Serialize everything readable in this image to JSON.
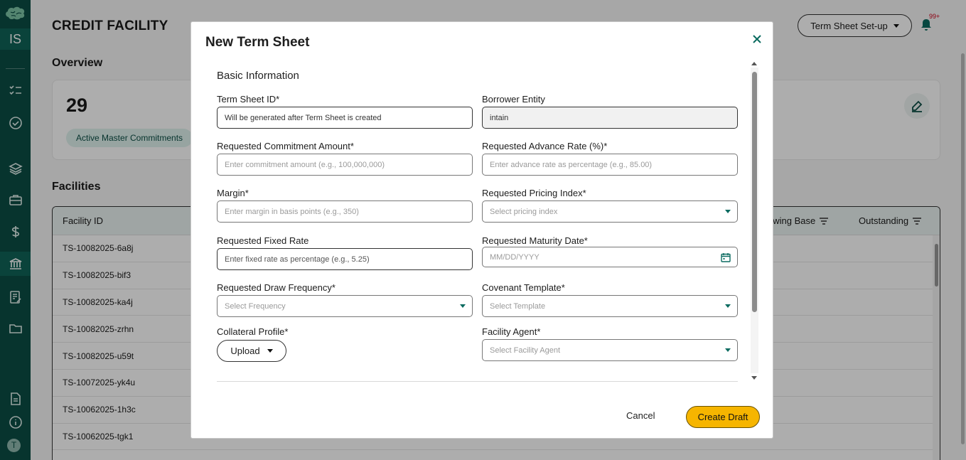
{
  "sidebar": {
    "initials": "IS",
    "avatar": "T",
    "icons": [
      "brain-logo-icon",
      "checklist-icon",
      "check-circle-icon",
      "layers-icon",
      "briefcase-icon",
      "dollar-icon",
      "bank-icon",
      "document-edit-icon",
      "folder-icon",
      "file-icon",
      "info-icon"
    ]
  },
  "page": {
    "title": "CREDIT FACILITY",
    "term_sheet_button": "Term Sheet Set-up",
    "notification_count": "99+",
    "overview_title": "Overview",
    "overview": {
      "count": "29",
      "chip": "Active Master Commitments"
    },
    "facilities_title": "Facilities",
    "table": {
      "columns": [
        "Facility ID",
        "owing Base",
        "Outstanding"
      ],
      "rows": [
        "TS-10082025-6a8j",
        "TS-10082025-bif3",
        "TS-10082025-ka4j",
        "TS-10082025-zrhn",
        "TS-10082025-u59t",
        "TS-10072025-yk4u",
        "TS-10062025-1h3c",
        "TS-10062025-tgk1"
      ]
    }
  },
  "modal": {
    "title": "New Term Sheet",
    "section": "Basic Information",
    "fields": {
      "term_sheet_id": {
        "label": "Term Sheet ID*",
        "value": "Will be generated after Term Sheet is created"
      },
      "borrower_entity": {
        "label": "Borrower Entity",
        "value": "intain"
      },
      "commitment_amount": {
        "label": "Requested Commitment Amount*",
        "placeholder": "Enter commitment amount (e.g., 100,000,000)"
      },
      "advance_rate": {
        "label": "Requested Advance Rate (%)*",
        "placeholder": "Enter advance rate as percentage (e.g., 85.00)"
      },
      "margin": {
        "label": "Margin*",
        "placeholder": "Enter margin in basis points (e.g., 350)"
      },
      "pricing_index": {
        "label": "Requested Pricing Index*",
        "placeholder": "Select pricing index"
      },
      "fixed_rate": {
        "label": "Requested Fixed Rate",
        "placeholder": "Enter fixed rate as percentage (e.g., 5.25)"
      },
      "maturity_date": {
        "label": "Requested Maturity Date*",
        "placeholder": "MM/DD/YYYY"
      },
      "draw_frequency": {
        "label": "Requested Draw Frequency*",
        "placeholder": "Select Frequency"
      },
      "covenant_template": {
        "label": "Covenant Template*",
        "placeholder": "Select Template"
      },
      "collateral_profile": {
        "label": "Collateral Profile*",
        "button": "Upload"
      },
      "facility_agent": {
        "label": "Facility Agent*",
        "placeholder": "Select Facility Agent"
      }
    },
    "cancel": "Cancel",
    "create": "Create Draft"
  },
  "colors": {
    "sidebar": "#0b4d44",
    "accent": "#0b6b60",
    "primary_button": "#f6b500"
  }
}
